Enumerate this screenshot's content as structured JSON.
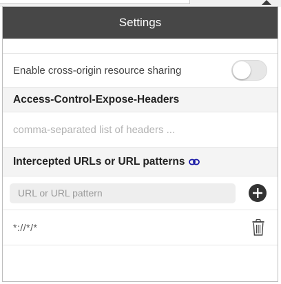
{
  "header": {
    "title": "Settings"
  },
  "cors": {
    "label": "Enable cross-origin resource sharing",
    "enabled": false
  },
  "expose_headers": {
    "title": "Access-Control-Expose-Headers",
    "placeholder": "comma-separated list of headers ..."
  },
  "intercepted": {
    "title": "Intercepted URLs or URL patterns",
    "input_placeholder": "URL or URL pattern",
    "items": [
      {
        "pattern": "*://*/*"
      }
    ]
  },
  "colors": {
    "header_bg": "#474747",
    "section_bg": "#f4f4f4",
    "link_icon": "#1a1aa6"
  },
  "icons": [
    "link-icon",
    "add-icon",
    "trash-icon"
  ]
}
